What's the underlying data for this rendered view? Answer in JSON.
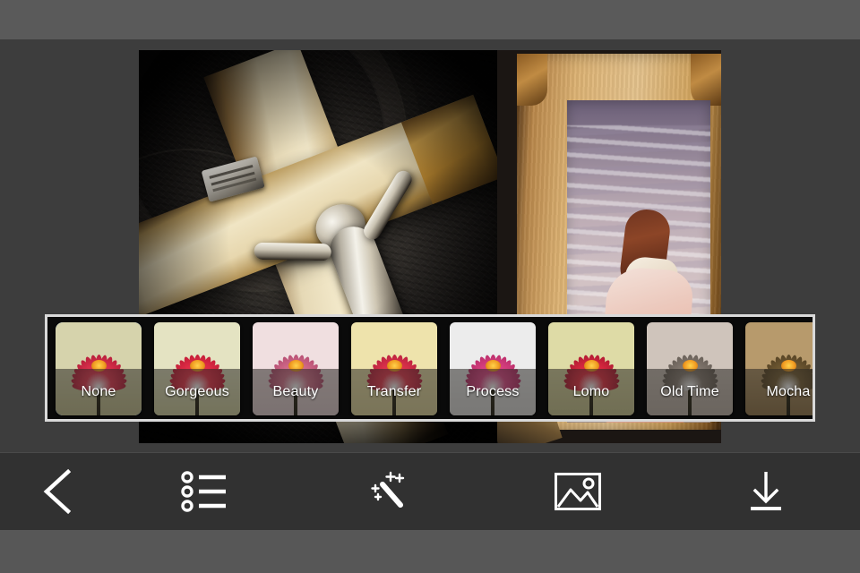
{
  "app": {
    "background_color": "#575757",
    "editor_background": "#3d3d3d",
    "toolbar_color": "#313131",
    "accent_color": "#1763e8"
  },
  "canvas": {
    "name": "photo-collage-canvas",
    "left_photo_description": "wooden crucifix with metallic corpus on dark embossed leather",
    "right_photo_description": "woman in pink dress standing at the sea inside a wooden picture frame"
  },
  "filter_strip": {
    "selected_index": 0,
    "selected_outline_color": "#1763e8",
    "border_color": "#d9d9d9",
    "items": [
      {
        "label": "None",
        "bg_top": "#d6d3ac",
        "bg_bottom": "#c3c08f",
        "petal": "#ee3a55",
        "petal_edge": "#b81f3b"
      },
      {
        "label": "Gorgeous",
        "bg_top": "#e4e3c2",
        "bg_bottom": "#d0d0a0",
        "petal": "#f2364f",
        "petal_edge": "#c51e38"
      },
      {
        "label": "Beauty",
        "bg_top": "#f0dfe0",
        "bg_bottom": "#e0cdd0",
        "petal": "#e07a96",
        "petal_edge": "#b85074"
      },
      {
        "label": "Transfer",
        "bg_top": "#eee3ac",
        "bg_bottom": "#ded49a",
        "petal": "#ef3a52",
        "petal_edge": "#bd2340"
      },
      {
        "label": "Process",
        "bg_top": "#ececec",
        "bg_bottom": "#dcdcdc",
        "petal": "#e84a8e",
        "petal_edge": "#bd2f6c"
      },
      {
        "label": "Lomo",
        "bg_top": "#dedba6",
        "bg_bottom": "#c9c68f",
        "petal": "#f03046",
        "petal_edge": "#b31b33"
      },
      {
        "label": "Old Time",
        "bg_top": "#cfc4bb",
        "bg_bottom": "#bdb2a9",
        "petal": "#8d8279",
        "petal_edge": "#6a6159"
      },
      {
        "label": "Mocha",
        "bg_top": "#b79a6c",
        "bg_bottom": "#8f7348",
        "petal": "#7a6238",
        "petal_edge": "#584526"
      }
    ]
  },
  "toolbar": {
    "items": [
      {
        "name": "back-button",
        "icon": "chevron-left-icon"
      },
      {
        "name": "layout-button",
        "icon": "list-icon"
      },
      {
        "name": "effects-button",
        "icon": "magic-wand-icon"
      },
      {
        "name": "gallery-button",
        "icon": "picture-icon"
      },
      {
        "name": "save-button",
        "icon": "download-icon"
      }
    ]
  }
}
